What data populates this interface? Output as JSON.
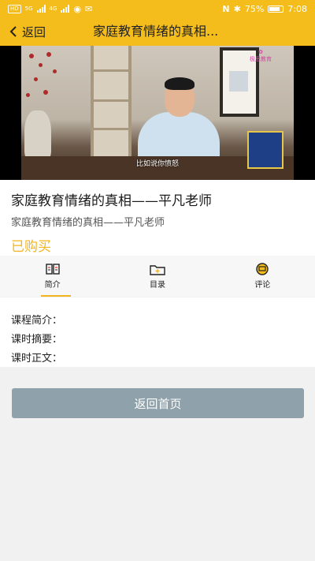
{
  "status_bar": {
    "net1": "HD",
    "net2": "5G",
    "net3": "4G",
    "battery_pct": "75%",
    "time": "7:08"
  },
  "nav": {
    "back_label": "返回",
    "title": "家庭教育情绪的真相..."
  },
  "video": {
    "subtitle": "比如说你愤怒",
    "logo_text": "极思教育"
  },
  "course": {
    "title": "家庭教育情绪的真相——平凡老师",
    "subtitle": "家庭教育情绪的真相——平凡老师",
    "status": "已购买"
  },
  "tabs": [
    {
      "label": "简介",
      "icon": "book-icon",
      "active": true
    },
    {
      "label": "目录",
      "icon": "folder-icon",
      "active": false
    },
    {
      "label": "评论",
      "icon": "comment-icon",
      "active": false
    }
  ],
  "details": {
    "intro_label": "课程简介：",
    "summary_label": "课时摘要：",
    "body_label": "课时正文："
  },
  "actions": {
    "home_button": "返回首页"
  },
  "colors": {
    "accent": "#f5bd1c",
    "purchased": "#f3b51f",
    "button": "#8fa1aa"
  }
}
